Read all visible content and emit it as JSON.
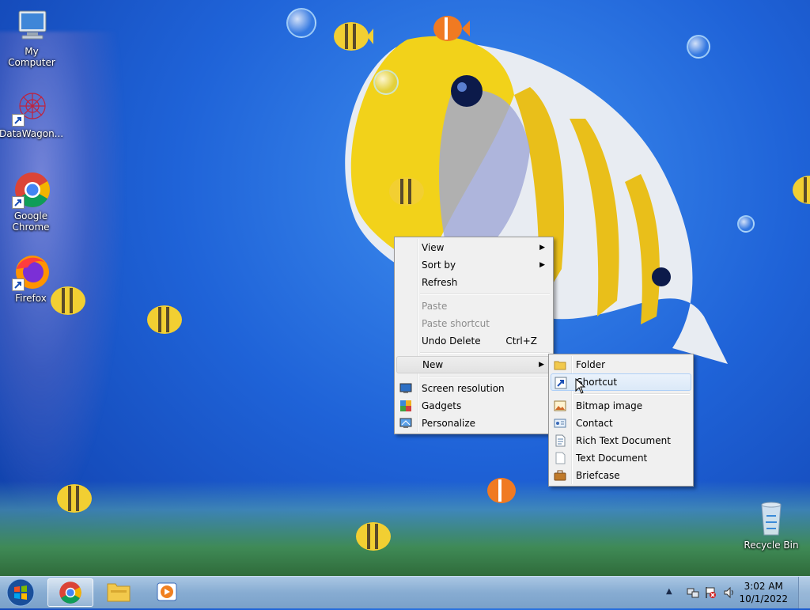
{
  "desktop": {
    "icons": [
      {
        "label": "My Computer"
      },
      {
        "label": "DataWagon..."
      },
      {
        "label": "Google Chrome"
      },
      {
        "label": "Firefox"
      },
      {
        "label": "Recycle Bin"
      }
    ]
  },
  "context_menu": {
    "items": {
      "view": "View",
      "sort_by": "Sort by",
      "refresh": "Refresh",
      "paste": "Paste",
      "paste_shortcut": "Paste shortcut",
      "undo_delete": "Undo Delete",
      "undo_delete_shortcut": "Ctrl+Z",
      "new": "New",
      "screen_resolution": "Screen resolution",
      "gadgets": "Gadgets",
      "personalize": "Personalize"
    }
  },
  "new_submenu": {
    "items": {
      "folder": "Folder",
      "shortcut": "Shortcut",
      "bitmap_image": "Bitmap image",
      "contact": "Contact",
      "rich_text_document": "Rich Text Document",
      "text_document": "Text Document",
      "briefcase": "Briefcase"
    }
  },
  "taskbar": {
    "clock_time": "3:02 AM",
    "clock_date": "10/1/2022"
  }
}
